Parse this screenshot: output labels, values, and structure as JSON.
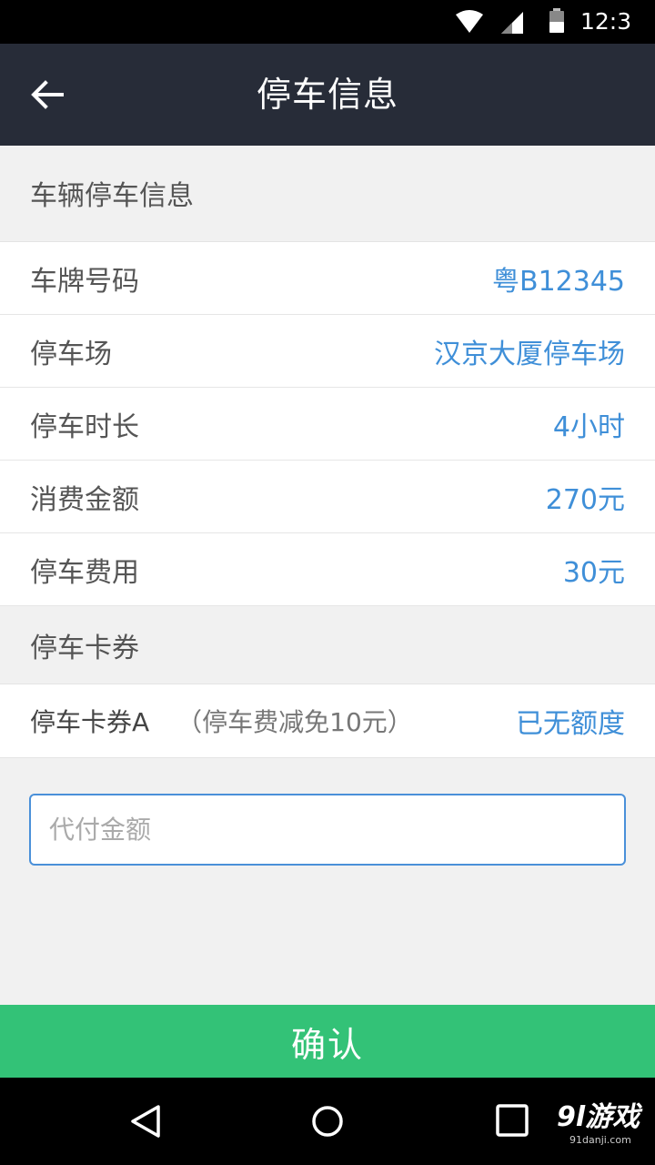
{
  "status_bar": {
    "time": "12:3"
  },
  "app_bar": {
    "title": "停车信息"
  },
  "vehicle_section": {
    "header": "车辆停车信息"
  },
  "info_rows": [
    {
      "label": "车牌号码",
      "value": "粤B12345"
    },
    {
      "label": "停车场",
      "value": "汉京大厦停车场"
    },
    {
      "label": "停车时长",
      "value": "4小时"
    },
    {
      "label": "消费金额",
      "value": "270元"
    },
    {
      "label": "停车费用",
      "value": "30元"
    }
  ],
  "coupon_section": {
    "header": "停车卡券"
  },
  "coupon": {
    "name": "停车卡券A",
    "desc": "（停车费减免10元）",
    "status": "已无额度"
  },
  "pay_input": {
    "placeholder": "代付金额",
    "value": ""
  },
  "confirm": {
    "label": "确认"
  },
  "watermark": {
    "brand": "9l游戏",
    "site": "91danji.com"
  },
  "colors": {
    "app_bar": "#272c38",
    "accent_blue": "#3f8fd8",
    "confirm_green": "#33c277"
  }
}
